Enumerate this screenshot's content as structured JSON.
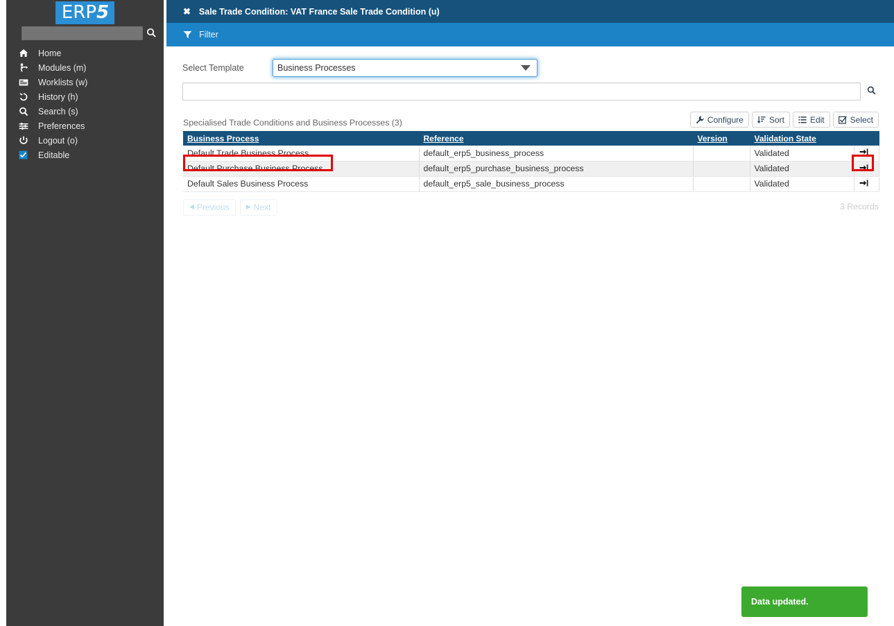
{
  "brand": {
    "logo_text": "ERP",
    "logo_accent": "5",
    "logo_bg": "#2b8fd4"
  },
  "sidebar": {
    "search": {
      "value": "",
      "placeholder": "",
      "icon": "search-icon"
    },
    "items": [
      {
        "label": "Home",
        "icon": "home-icon"
      },
      {
        "label": "Modules (m)",
        "icon": "modules-icon"
      },
      {
        "label": "Worklists (w)",
        "icon": "worklists-icon"
      },
      {
        "label": "History (h)",
        "icon": "history-icon"
      },
      {
        "label": "Search (s)",
        "icon": "search-icon"
      },
      {
        "label": "Preferences",
        "icon": "sliders-icon"
      },
      {
        "label": "Logout (o)",
        "icon": "power-icon"
      },
      {
        "label": "Editable",
        "icon": "checkbox-checked-icon"
      }
    ]
  },
  "header": {
    "close_icon": "close-icon",
    "title": "Sale Trade Condition: VAT France Sale Trade Condition (u)",
    "bg": "#16527c"
  },
  "filter_bar": {
    "label": "Filter",
    "icon": "funnel-icon",
    "bg": "#1b83c6"
  },
  "form": {
    "template_label": "Select Template",
    "template_value": "Business Processes",
    "template_options": [
      "Business Processes"
    ],
    "search_value": "",
    "search_placeholder": "",
    "search_icon": "search-icon"
  },
  "listbox": {
    "title": "Specialised Trade Conditions and Business Processes (3)",
    "buttons": [
      {
        "label": "Configure",
        "icon": "wrench-icon"
      },
      {
        "label": "Sort",
        "icon": "sort-icon"
      },
      {
        "label": "Edit",
        "icon": "list-icon"
      },
      {
        "label": "Select",
        "icon": "checkbox-icon"
      }
    ],
    "columns": [
      "Business Process",
      "Reference",
      "Version",
      "Validation State",
      ""
    ],
    "rows": [
      {
        "business_process": "Default Trade Business Process",
        "reference": "default_erp5_business_process",
        "version": "",
        "validation_state": "Validated",
        "action_icon": "sign-in-icon"
      },
      {
        "business_process": "Default Purchase Business Process",
        "reference": "default_erp5_purchase_business_process",
        "version": "",
        "validation_state": "Validated",
        "action_icon": "sign-in-icon"
      },
      {
        "business_process": "Default Sales Business Process",
        "reference": "default_erp5_sale_business_process",
        "version": "",
        "validation_state": "Validated",
        "action_icon": "sign-in-icon"
      }
    ],
    "pagination": {
      "previous": "Previous",
      "next": "Next"
    },
    "records": "3 Records"
  },
  "toast": {
    "message": "Data updated.",
    "color": "#3caa2e"
  },
  "highlights": {
    "color": "#e00000"
  }
}
